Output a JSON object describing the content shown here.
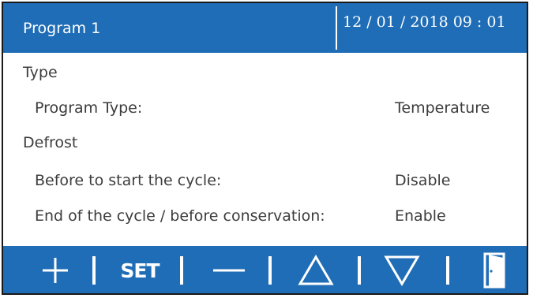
{
  "header": {
    "title": "Program 1",
    "datetime": "12 / 01 / 2018  09 : 01"
  },
  "settings": [
    {
      "label": "Type",
      "value": "",
      "indent": false
    },
    {
      "label": "Program Type:",
      "value": "Temperature",
      "indent": true
    },
    {
      "label": "Defrost",
      "value": "",
      "indent": false
    },
    {
      "label": "Before to start the cycle:",
      "value": "Disable",
      "indent": true
    },
    {
      "label": "End of the cycle / before conservation:",
      "value": "Enable",
      "indent": true
    }
  ],
  "toolbar": {
    "set_label": "SET",
    "icons": [
      "plus-icon",
      "set",
      "minus-icon",
      "arrow-up-icon",
      "arrow-down-icon",
      "exit-door-icon"
    ]
  },
  "colors": {
    "accent": "#1f6db6",
    "text": "#3c3c3c",
    "background": "#ffffff"
  }
}
